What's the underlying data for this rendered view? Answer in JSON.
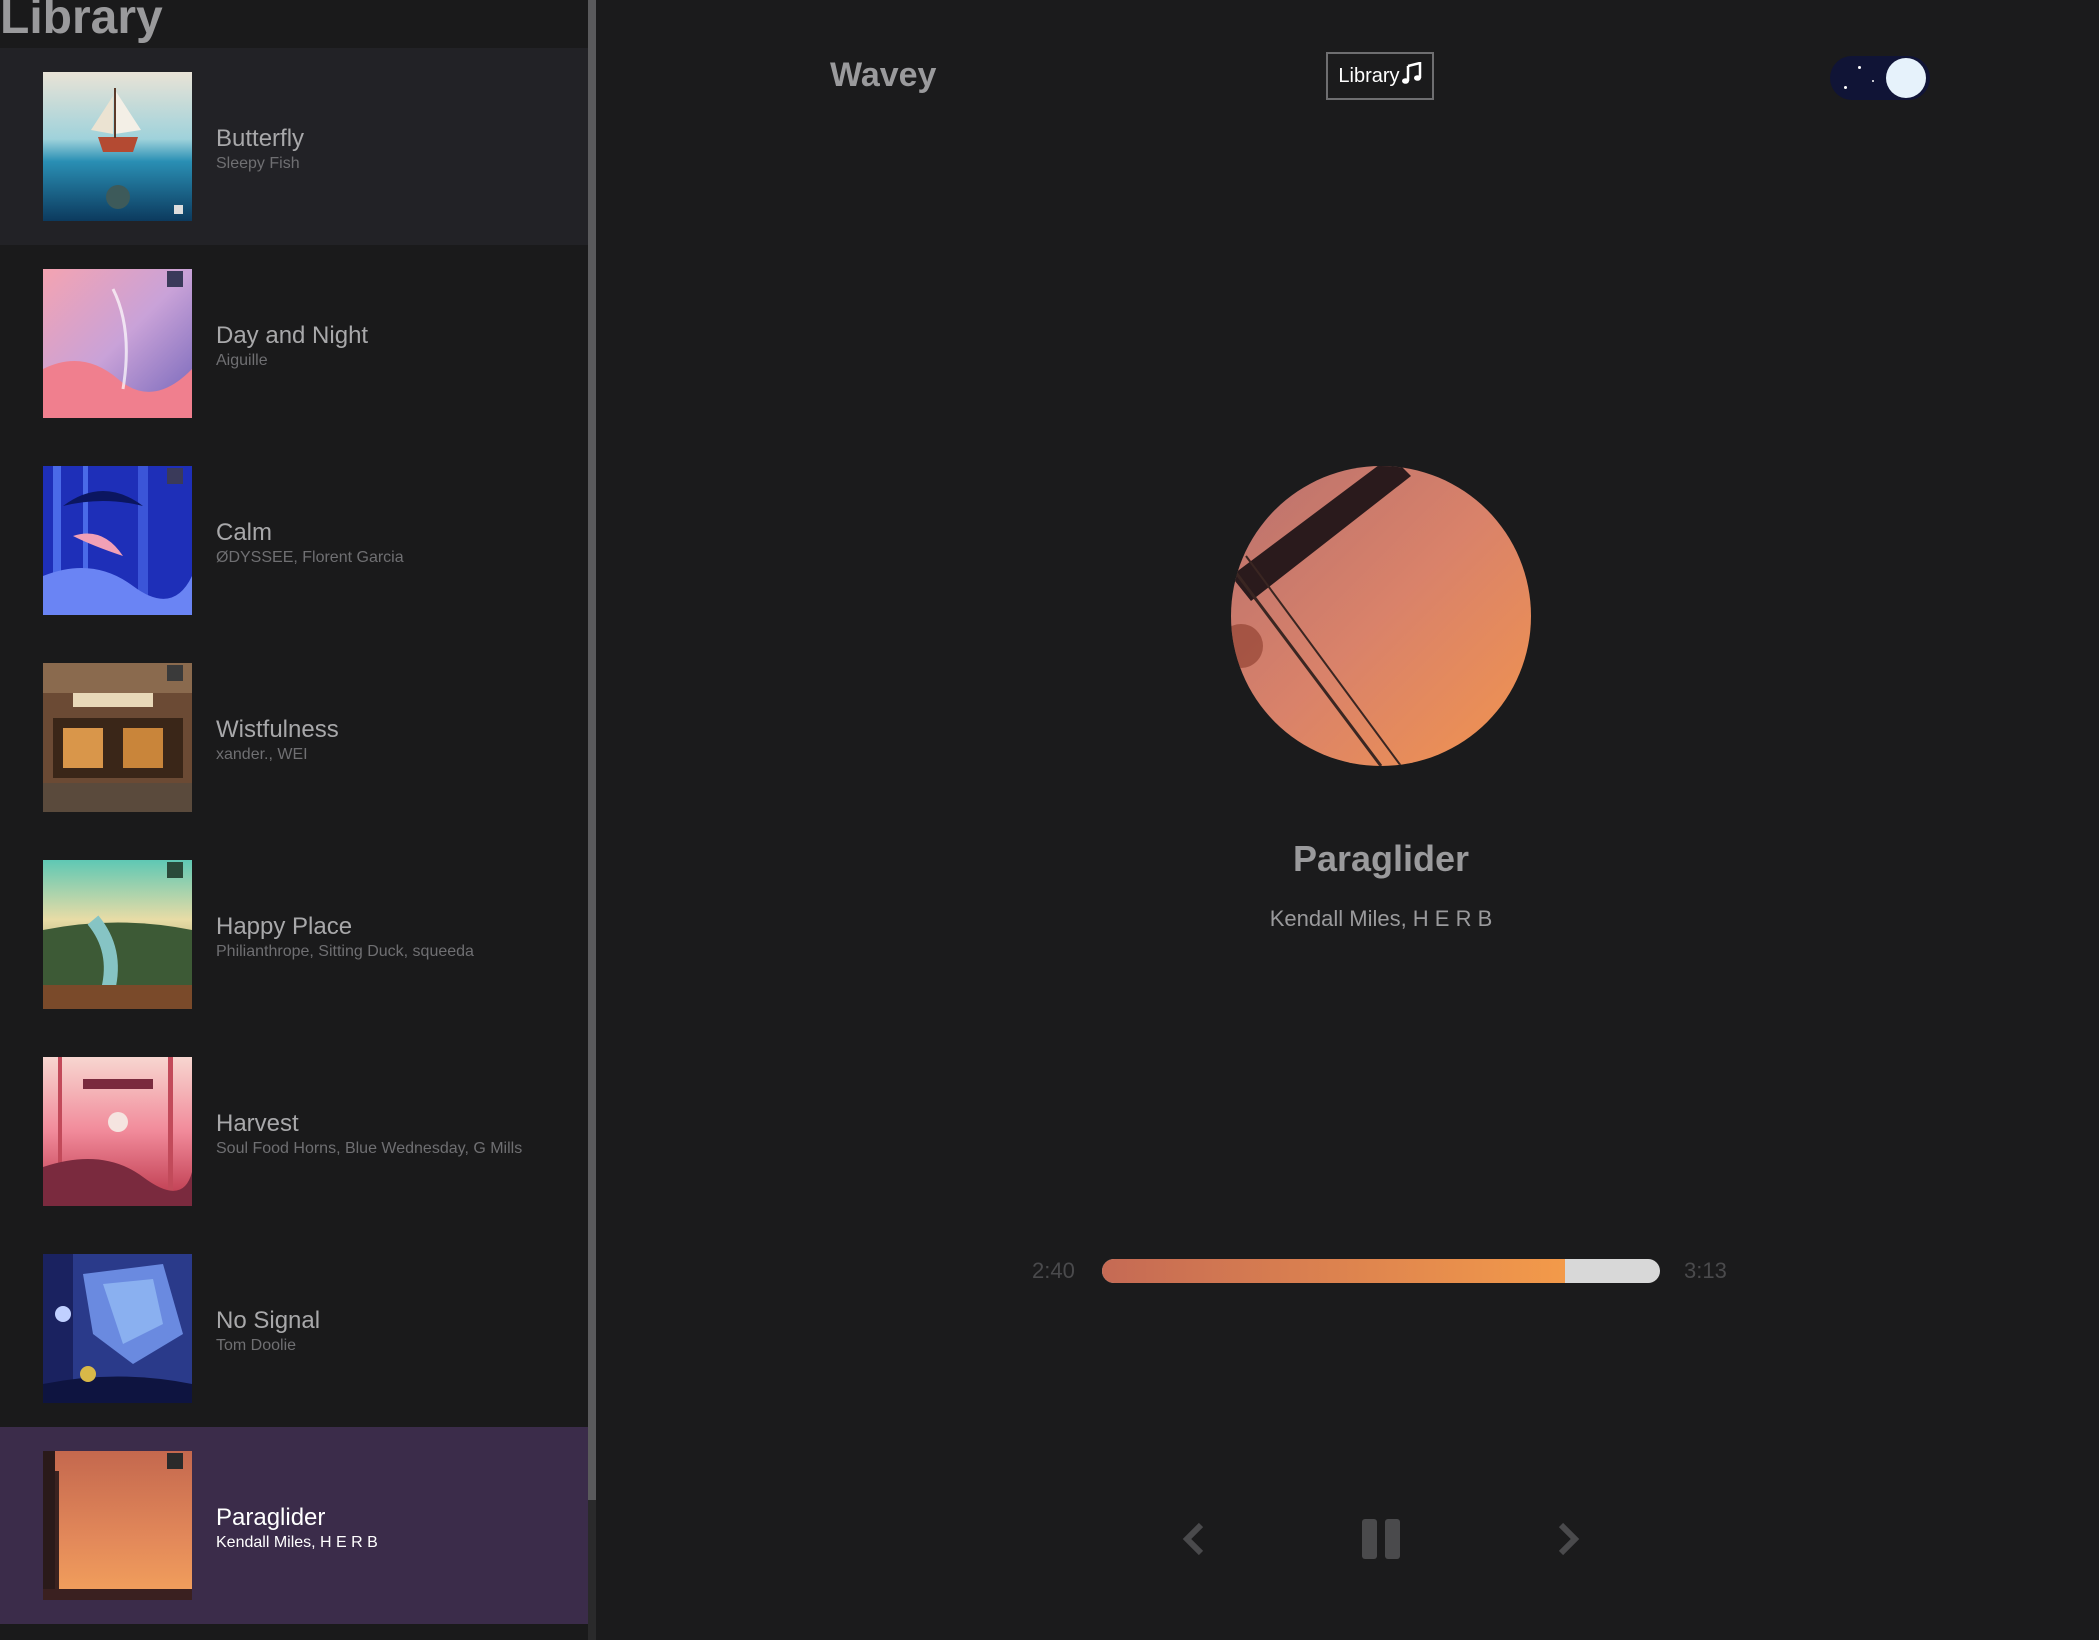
{
  "library": {
    "title": "Library",
    "songs": [
      {
        "name": "Butterfly",
        "artist": "Sleepy Fish",
        "state": "hover"
      },
      {
        "name": "Day and Night",
        "artist": "Aiguille",
        "state": ""
      },
      {
        "name": "Calm",
        "artist": "ØDYSSEE, Florent Garcia",
        "state": ""
      },
      {
        "name": "Wistfulness",
        "artist": "xander., WEI",
        "state": ""
      },
      {
        "name": "Happy Place",
        "artist": "Philianthrope, Sitting Duck, squeeda",
        "state": ""
      },
      {
        "name": "Harvest",
        "artist": "Soul Food Horns, Blue Wednesday, G Mills",
        "state": ""
      },
      {
        "name": "No Signal",
        "artist": "Tom Doolie",
        "state": ""
      },
      {
        "name": "Paraglider",
        "artist": "Kendall Miles, H E R B",
        "state": "active"
      }
    ]
  },
  "nav": {
    "brand": "Wavey",
    "library_button": "Library",
    "library_icon": "music-note-icon",
    "theme_toggle_icon": "moon-icon"
  },
  "now_playing": {
    "title": "Paraglider",
    "artist": "Kendall Miles, H E R B"
  },
  "player": {
    "current_time": "2:40",
    "total_time": "3:13",
    "progress": 0.83,
    "prev_icon": "chevron-left-icon",
    "play_icon": "pause-icon",
    "next_icon": "chevron-right-icon"
  },
  "colors": {
    "active_row": "#3b2c4a",
    "progress_start": "#c56a54",
    "progress_end": "#f39a4a",
    "toggle_bg": "#101436"
  }
}
